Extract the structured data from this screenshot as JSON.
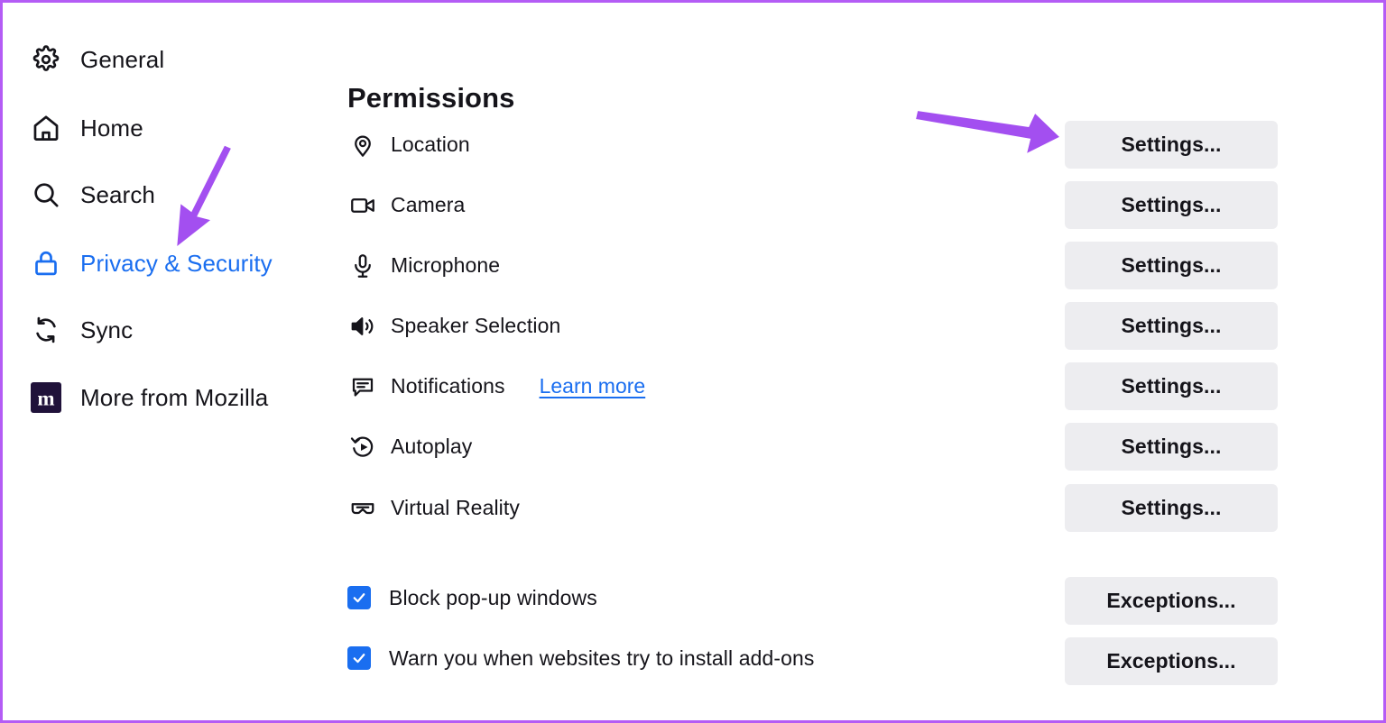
{
  "window": {
    "border_color": "#b45cf5"
  },
  "colors": {
    "accent_blue": "#1a6ef0",
    "text": "#15141a",
    "button_bg": "#ededf0",
    "annotation_purple": "#a34ff0"
  },
  "sidebar": {
    "items": [
      {
        "label": "General",
        "icon": "gear-icon",
        "active": false
      },
      {
        "label": "Home",
        "icon": "home-icon",
        "active": false
      },
      {
        "label": "Search",
        "icon": "search-icon",
        "active": false
      },
      {
        "label": "Privacy & Security",
        "icon": "lock-icon",
        "active": true
      },
      {
        "label": "Sync",
        "icon": "sync-icon",
        "active": false
      },
      {
        "label": "More from Mozilla",
        "icon": "mozilla-icon",
        "active": false
      }
    ]
  },
  "main": {
    "title": "Permissions",
    "permissions": [
      {
        "label": "Location",
        "icon": "location-pin-icon",
        "button": "Settings...",
        "link": null
      },
      {
        "label": "Camera",
        "icon": "camera-icon",
        "button": "Settings...",
        "link": null
      },
      {
        "label": "Microphone",
        "icon": "microphone-icon",
        "button": "Settings...",
        "link": null
      },
      {
        "label": "Speaker Selection",
        "icon": "speaker-icon",
        "button": "Settings...",
        "link": null
      },
      {
        "label": "Notifications",
        "icon": "notification-icon",
        "button": "Settings...",
        "link": "Learn more"
      },
      {
        "label": "Autoplay",
        "icon": "autoplay-icon",
        "button": "Settings...",
        "link": null
      },
      {
        "label": "Virtual Reality",
        "icon": "vr-headset-icon",
        "button": "Settings...",
        "link": null
      }
    ],
    "checkboxes": [
      {
        "label": "Block pop-up windows",
        "checked": true,
        "button": "Exceptions..."
      },
      {
        "label": "Warn you when websites try to install add-ons",
        "checked": true,
        "button": "Exceptions..."
      }
    ]
  },
  "annotations": [
    {
      "name": "arrow-to-privacy-security",
      "shape": "arrow"
    },
    {
      "name": "arrow-to-settings-button",
      "shape": "arrow"
    }
  ]
}
